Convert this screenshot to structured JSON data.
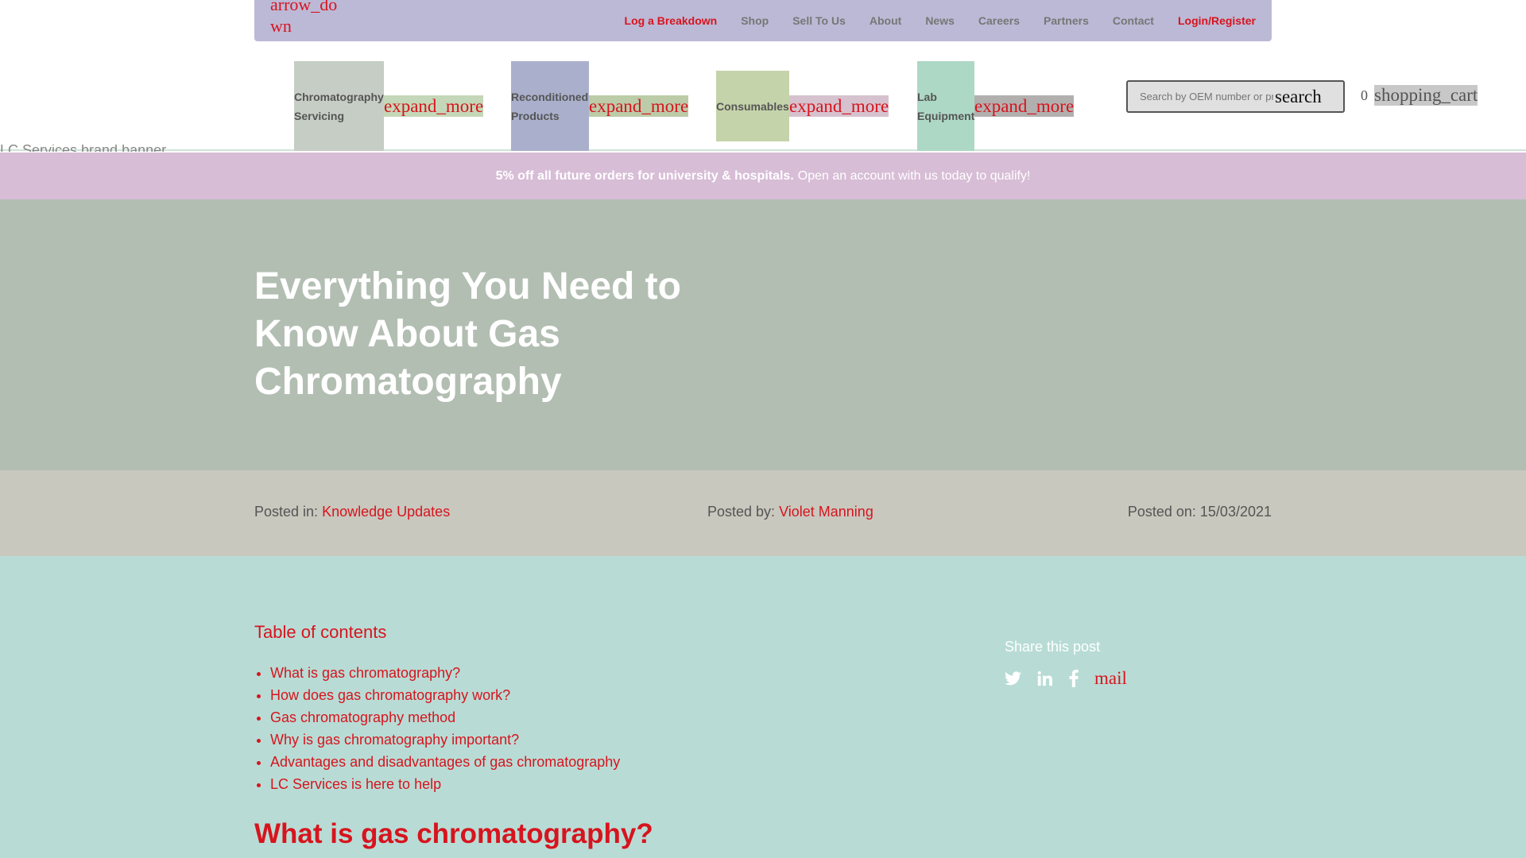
{
  "topbar": {
    "toggle_icon_text": "arrow_down",
    "links": [
      {
        "label": "Log a Breakdown",
        "highlight": true
      },
      {
        "label": "Shop",
        "highlight": false
      },
      {
        "label": "Sell To Us",
        "highlight": false
      },
      {
        "label": "About",
        "highlight": false
      },
      {
        "label": "News",
        "highlight": false
      },
      {
        "label": "Careers",
        "highlight": false
      },
      {
        "label": "Partners",
        "highlight": false
      },
      {
        "label": "Contact",
        "highlight": false
      },
      {
        "label": "Login/Register",
        "highlight": true
      }
    ]
  },
  "mainnav": {
    "items": [
      {
        "label": "Chromatography Servicing",
        "icon_text": "expand_more"
      },
      {
        "label": "Reconditioned Products",
        "icon_text": "expand_more"
      },
      {
        "label": "Consumables",
        "icon_text": "expand_more"
      },
      {
        "label": "Lab Equipment",
        "icon_text": "expand_more"
      }
    ],
    "search": {
      "placeholder": "Search by OEM number or product",
      "button_icon_text": "search"
    },
    "cart": {
      "count": "0",
      "icon_text": "shopping_cart"
    },
    "broken_image_alt": "LC Services brand banner"
  },
  "promo": {
    "bold_text": "5% off all future orders for university & hospitals.",
    "text": "Open an account with us today to qualify!"
  },
  "hero": {
    "title": "Everything You Need to Know About Gas Chromatography"
  },
  "meta": {
    "category_label": "Posted in:",
    "category": "Knowledge Updates",
    "author_label": "Posted by:",
    "author": "Violet Manning",
    "date_label": "Posted on:",
    "date": "15/03/2021"
  },
  "toc": {
    "title": "Table of contents",
    "items": [
      "What is gas chromatography?",
      "How does gas chromatography work?",
      "Gas chromatography method",
      "Why is gas chromatography important?",
      "Advantages and disadvantages of gas chromatography",
      "LC Services is here to help"
    ]
  },
  "share": {
    "title": "Share this post",
    "icons": [
      "twitter-icon",
      "linkedin-icon",
      "facebook-icon"
    ],
    "mail_icon_text": "mail"
  },
  "article": {
    "first_heading": "What is gas chromatography?"
  },
  "colors": {
    "accent": "#d7141e",
    "topbar": "#bcb9d6",
    "promo": "#d7bdd6",
    "hero": "#b3beb3",
    "metabar": "#c8c8be",
    "content": "#b8dcd5"
  }
}
